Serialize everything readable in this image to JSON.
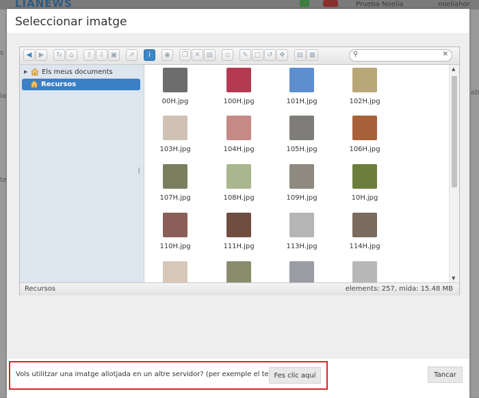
{
  "background": {
    "logo": "LIANEWS",
    "user_name": "Prueba Noelia",
    "user_email": "noeliahor",
    "side_fragments": [
      "s",
      "ial",
      "te",
      "ab"
    ]
  },
  "dialog": {
    "title": "Seleccionar imatge"
  },
  "toolbar": {
    "buttons": [
      "back-icon",
      "forward-icon",
      "reload-icon",
      "home-icon",
      "upload-icon",
      "download-icon",
      "save-icon",
      "select-icon",
      "info-icon",
      "view-icon",
      "copy-icon",
      "cut-icon",
      "paste-icon",
      "rename-icon",
      "edit-icon",
      "crop-icon",
      "rotate-icon",
      "resize-icon",
      "list-view-icon",
      "icon-view-icon"
    ],
    "search": {
      "placeholder": "",
      "value": ""
    }
  },
  "tree": {
    "items": [
      {
        "label": "Els meus documents",
        "icon": "home-icon",
        "selected": false
      },
      {
        "label": "Recursos",
        "icon": "home-icon",
        "selected": true
      }
    ]
  },
  "files": [
    {
      "name": "00H.jpg",
      "color": "#6d6d6d"
    },
    {
      "name": "100H.jpg",
      "color": "#b33a52"
    },
    {
      "name": "101H.jpg",
      "color": "#5d8fd0"
    },
    {
      "name": "102H.jpg",
      "color": "#b9a777"
    },
    {
      "name": "103H.jpg",
      "color": "#cfc2b4"
    },
    {
      "name": "104H.jpg",
      "color": "#c48a86"
    },
    {
      "name": "105H.jpg",
      "color": "#7f7d79"
    },
    {
      "name": "106H.jpg",
      "color": "#a7623a"
    },
    {
      "name": "107H.jpg",
      "color": "#7a7e5e"
    },
    {
      "name": "108H.jpg",
      "color": "#a9b68e"
    },
    {
      "name": "109H.jpg",
      "color": "#8f8a80"
    },
    {
      "name": "10H.jpg",
      "color": "#6c7d3c"
    },
    {
      "name": "110H.jpg",
      "color": "#8a5f58"
    },
    {
      "name": "111H.jpg",
      "color": "#6f4e40"
    },
    {
      "name": "113H.jpg",
      "color": "#b5b5b5"
    },
    {
      "name": "114H.jpg",
      "color": "#7a6b5e"
    },
    {
      "name": "",
      "color": "#d7c7b8"
    },
    {
      "name": "",
      "color": "#8a8c6c"
    },
    {
      "name": "",
      "color": "#9a9da4"
    },
    {
      "name": "",
      "color": "#b7b7b7"
    }
  ],
  "status": {
    "folder": "Recursos",
    "summary": "elements: 257, mida: 15.48 MB"
  },
  "footer": {
    "external_text": "Vols utilitzar una imatge allotjada en un altre servidor? (per exemple el teu web)?",
    "click_label": "Fes clic aquí",
    "cancel_label": "Tancar"
  },
  "colors": {
    "accent": "#3b7fc4",
    "highlight_border": "#e0202a"
  }
}
